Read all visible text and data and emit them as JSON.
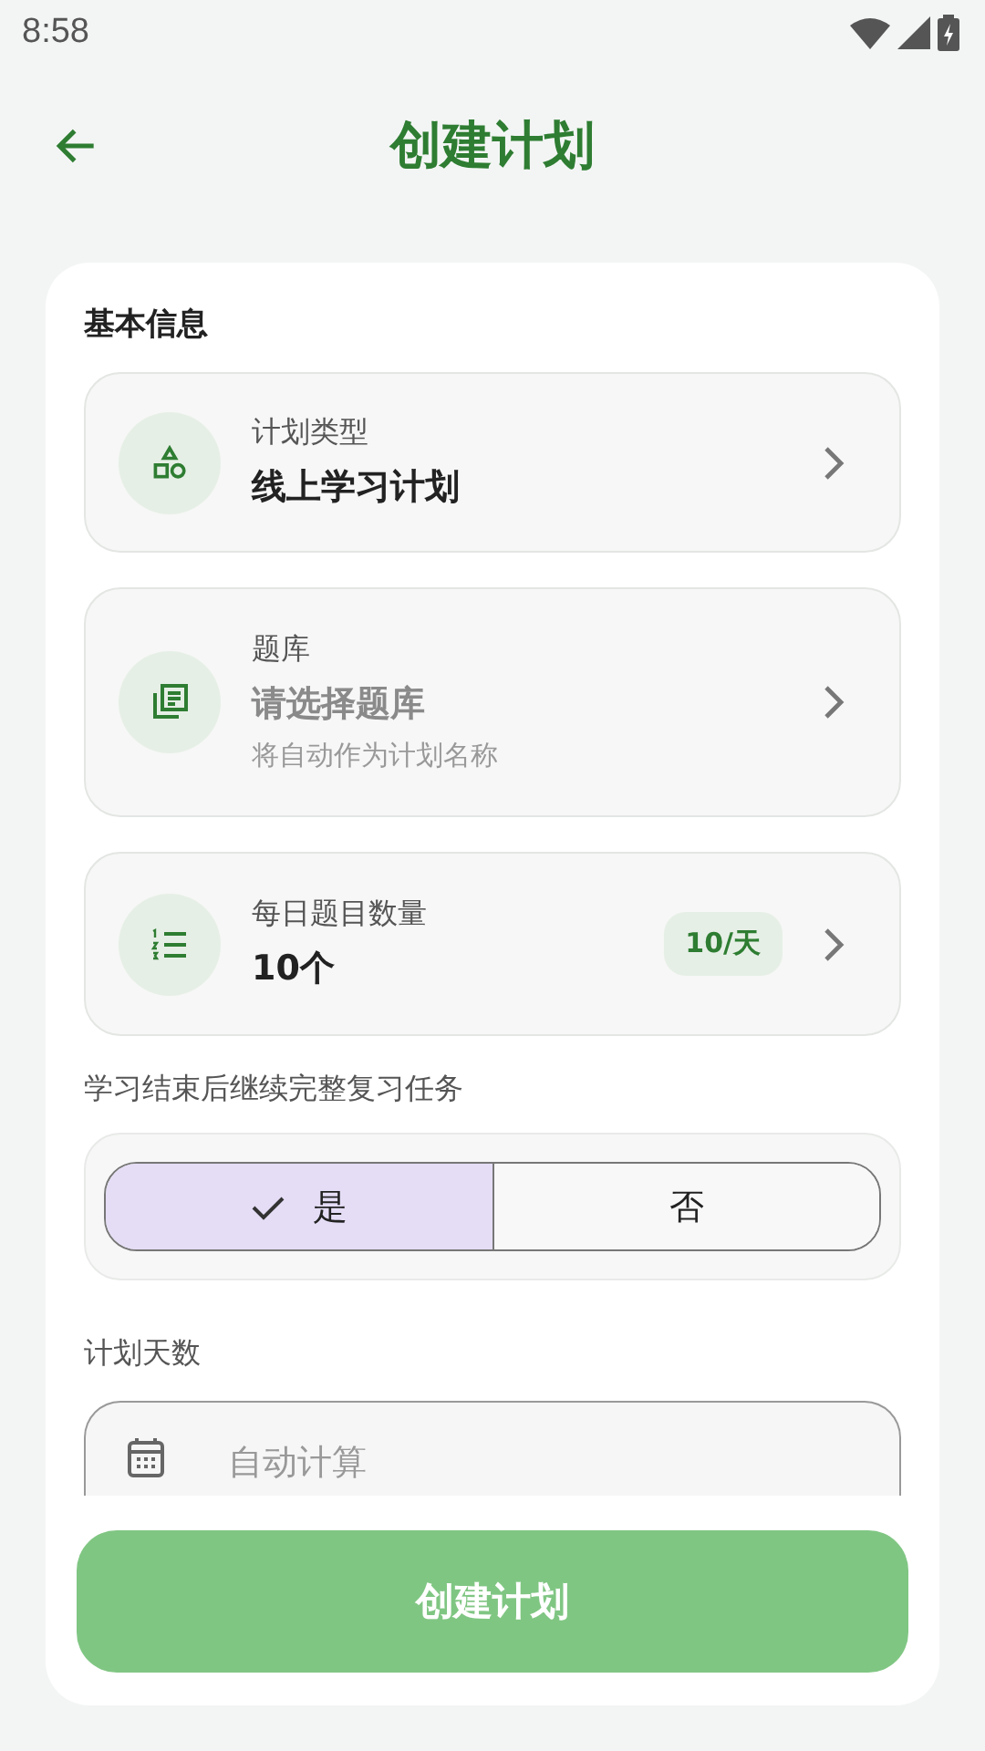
{
  "status_bar": {
    "time": "8:58"
  },
  "header": {
    "title": "创建计划"
  },
  "section": {
    "title": "基本信息"
  },
  "items": [
    {
      "label": "计划类型",
      "value": "线上学习计划"
    },
    {
      "label": "题库",
      "placeholder": "请选择题库",
      "hint": "将自动作为计划名称"
    },
    {
      "label": "每日题目数量",
      "value": "10个",
      "badge": "10/天"
    }
  ],
  "review": {
    "label": "学习结束后继续完整复习任务",
    "options": [
      {
        "label": "是",
        "selected": true
      },
      {
        "label": "否",
        "selected": false
      }
    ]
  },
  "days": {
    "label": "计划天数",
    "placeholder": "自动计算"
  },
  "submit": {
    "label": "创建计划"
  }
}
